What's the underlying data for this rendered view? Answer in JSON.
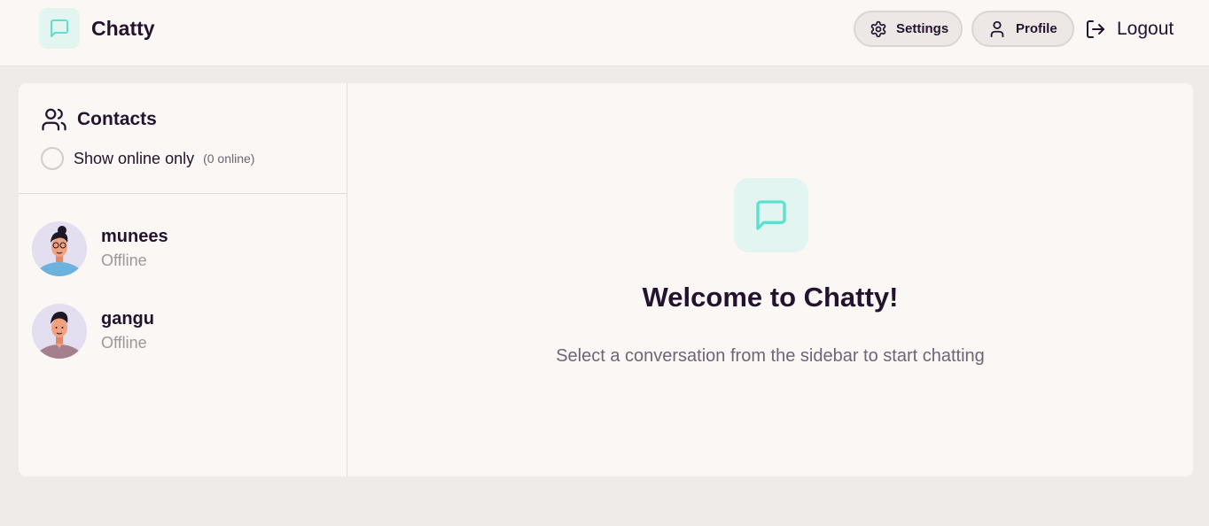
{
  "app": {
    "name": "Chatty",
    "logo_icon": "message-square-icon",
    "accent": "#5de0d0"
  },
  "header": {
    "settings_label": "Settings",
    "profile_label": "Profile",
    "logout_label": "Logout"
  },
  "sidebar": {
    "title": "Contacts",
    "filter_label": "Show online only",
    "online_count": "(0 online)",
    "contacts": [
      {
        "name": "munees",
        "status": "Offline",
        "avatar_bg": "#e4dff0",
        "shirt": "#6bb3dc"
      },
      {
        "name": "gangu",
        "status": "Offline",
        "avatar_bg": "#e4dff0",
        "shirt": "#a67f8e"
      }
    ]
  },
  "welcome": {
    "title": "Welcome to Chatty!",
    "subtitle": "Select a conversation from the sidebar to start chatting"
  }
}
